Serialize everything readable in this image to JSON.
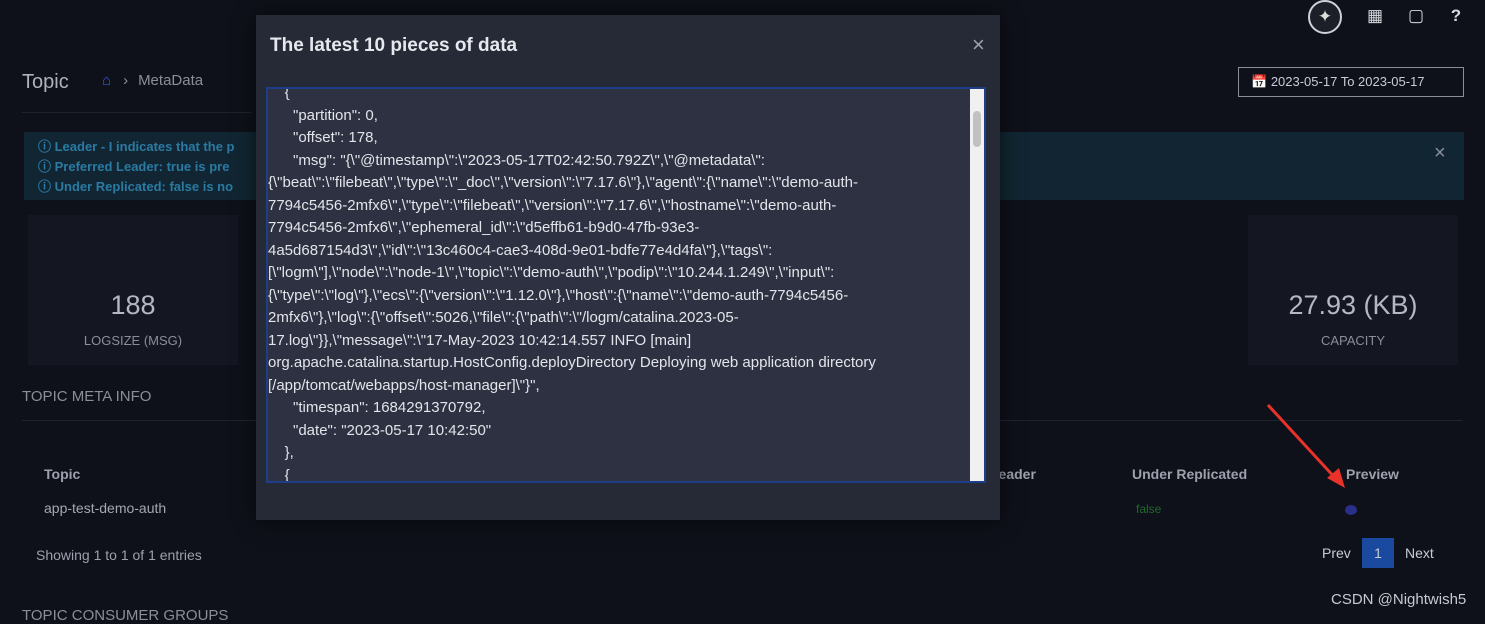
{
  "header": {
    "avatar_icon": "feather-icon",
    "icons": [
      "grid-icon",
      "cube-icon",
      "help-icon"
    ],
    "help_label": "?"
  },
  "page": {
    "title": "Topic",
    "breadcrumb": "MetaData",
    "date_range": "2023-05-17 To 2023-05-17"
  },
  "alert": {
    "lines": [
      "ⓘ Leader - I indicates that the p",
      "ⓘ Preferred Leader: true is pre",
      "ⓘ Under Replicated: false is no"
    ]
  },
  "stats": [
    {
      "value": "188",
      "label": "LOGSIZE (MSG)"
    },
    {
      "value": "27.93 (KB)",
      "label": "CAPACITY"
    }
  ],
  "meta": {
    "section": "TOPIC META INFO",
    "columns": [
      "Topic",
      "Leader",
      "Under Replicated",
      "Preview"
    ],
    "rows": [
      {
        "topic": "app-test-demo-auth",
        "under_replicated": "false"
      }
    ],
    "showing": "Showing 1 to 1 of 1 entries",
    "pagination": {
      "prev": "Prev",
      "current": "1",
      "next": "Next"
    }
  },
  "section2": "TOPIC CONSUMER GROUPS",
  "watermark": "CSDN @Nightwish5",
  "modal": {
    "title": "The latest 10 pieces of data",
    "close": "×",
    "content": "    {\n      \"partition\": 0,\n      \"offset\": 178,\n      \"msg\": \"{\\\"@timestamp\\\":\\\"2023-05-17T02:42:50.792Z\\\",\\\"@metadata\\\":\n{\\\"beat\\\":\\\"filebeat\\\",\\\"type\\\":\\\"_doc\\\",\\\"version\\\":\\\"7.17.6\\\"},\\\"agent\\\":{\\\"name\\\":\\\"demo-auth-\n7794c5456-2mfx6\\\",\\\"type\\\":\\\"filebeat\\\",\\\"version\\\":\\\"7.17.6\\\",\\\"hostname\\\":\\\"demo-auth-\n7794c5456-2mfx6\\\",\\\"ephemeral_id\\\":\\\"d5effb61-b9d0-47fb-93e3-\n4a5d687154d3\\\",\\\"id\\\":\\\"13c460c4-cae3-408d-9e01-bdfe77e4d4fa\\\"},\\\"tags\\\":\n[\\\"logm\\\"],\\\"node\\\":\\\"node-1\\\",\\\"topic\\\":\\\"demo-auth\\\",\\\"podip\\\":\\\"10.244.1.249\\\",\\\"input\\\":\n{\\\"type\\\":\\\"log\\\"},\\\"ecs\\\":{\\\"version\\\":\\\"1.12.0\\\"},\\\"host\\\":{\\\"name\\\":\\\"demo-auth-7794c5456-\n2mfx6\\\"},\\\"log\\\":{\\\"offset\\\":5026,\\\"file\\\":{\\\"path\\\":\\\"/logm/catalina.2023-05-\n17.log\\\"}},\\\"message\\\":\\\"17-May-2023 10:42:14.557 INFO [main]\norg.apache.catalina.startup.HostConfig.deployDirectory Deploying web application directory\n[/app/tomcat/webapps/host-manager]\\\"}\",\n      \"timespan\": 1684291370792,\n      \"date\": \"2023-05-17 10:42:50\"\n    },\n    {"
  }
}
